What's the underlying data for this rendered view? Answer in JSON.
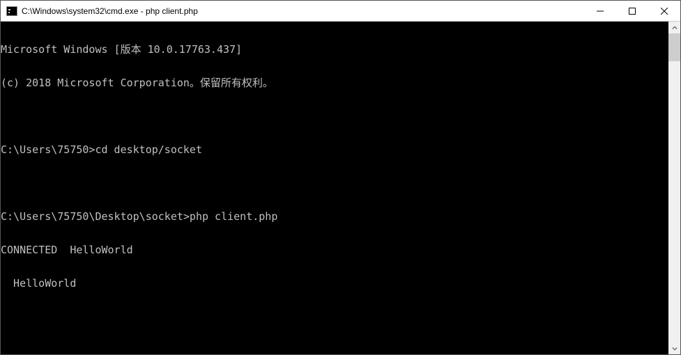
{
  "window": {
    "title": "C:\\Windows\\system32\\cmd.exe - php  client.php"
  },
  "terminal": {
    "lines": [
      "Microsoft Windows [版本 10.0.17763.437]",
      "(c) 2018 Microsoft Corporation。保留所有权利。",
      "",
      "C:\\Users\\75750>cd desktop/socket",
      "",
      "C:\\Users\\75750\\Desktop\\socket>php client.php",
      "CONNECTED  HelloWorld",
      "  HelloWorld"
    ]
  }
}
